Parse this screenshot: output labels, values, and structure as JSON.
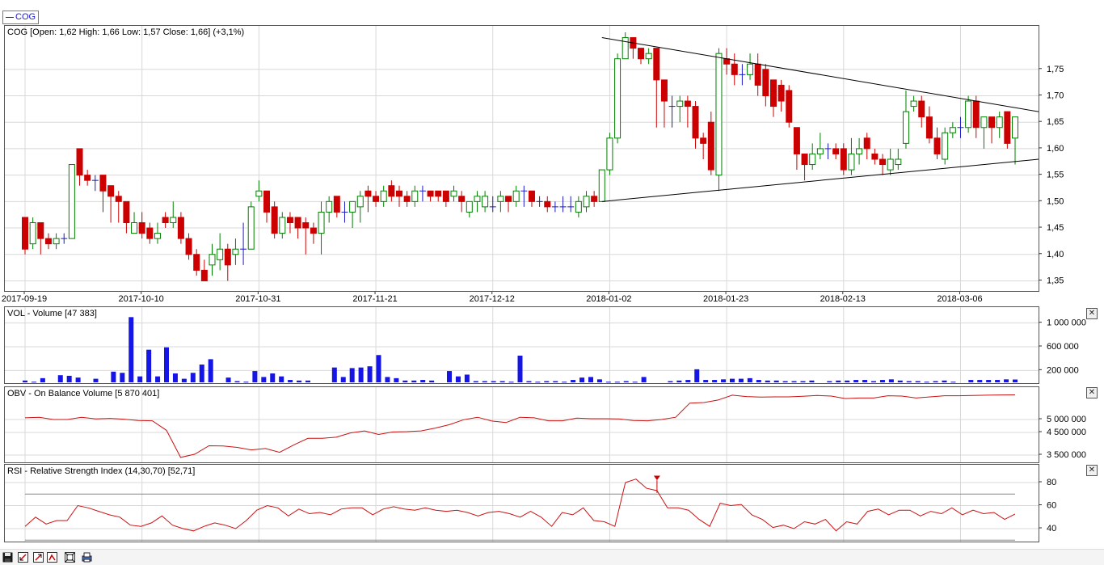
{
  "legend": {
    "label": "COG"
  },
  "main": {
    "title": "COG [Open: 1,62  High: 1,66  Low: 1,57  Close: 1,66] (+3,1%)",
    "y_ticks": [
      "1,35",
      "1,40",
      "1,45",
      "1,50",
      "1,55",
      "1,60",
      "1,65",
      "1,70",
      "1,75"
    ],
    "x_ticks": [
      "2017-09-19",
      "2017-10-10",
      "2017-10-31",
      "2017-11-21",
      "2017-12-12",
      "2018-01-02",
      "2018-01-23",
      "2018-02-13",
      "2018-03-06"
    ]
  },
  "volume": {
    "title": "VOL - Volume [47 383]",
    "y_ticks": [
      "200 000",
      "600 000",
      "1 000 000"
    ]
  },
  "obv": {
    "title": "OBV - On Balance Volume [5 870 401]",
    "y_ticks": [
      "3 500 000",
      "4 500 000",
      "5 000 000"
    ]
  },
  "rsi": {
    "title": "RSI - Relative Strength Index (14,30,70) [52,71]",
    "y_ticks": [
      "40",
      "60",
      "80"
    ]
  },
  "colors": {
    "up": "#008000",
    "down": "#cc0000",
    "up_fill": "#ffffff",
    "doji": "#1a1ac8",
    "volume": "#1515e6",
    "line": "#cc1111",
    "grid": "#d8d8d8"
  },
  "icons": [
    "save-icon",
    "zoom-out-icon",
    "zoom-in-icon",
    "zoom-reset-icon",
    "fit-icon",
    "print-icon"
  ],
  "chart_data": [
    {
      "type": "candlestick",
      "title": "COG [Open: 1,62  High: 1,66  Low: 1,57  Close: 1,66] (+3,1%)",
      "x": [
        "2017-09-19",
        "2017-10-10",
        "2017-10-31",
        "2017-11-21",
        "2017-12-12",
        "2018-01-02",
        "2018-01-23",
        "2018-02-13",
        "2018-03-06"
      ],
      "ylim": [
        1.34,
        1.82
      ],
      "candles": [
        [
          1.47,
          1.41,
          1.47,
          1.4
        ],
        [
          1.42,
          1.46,
          1.47,
          1.41
        ],
        [
          1.46,
          1.43,
          1.46,
          1.4
        ],
        [
          1.43,
          1.42,
          1.44,
          1.41
        ],
        [
          1.42,
          1.43,
          1.44,
          1.41
        ],
        [
          1.43,
          1.43,
          1.44,
          1.42
        ],
        [
          1.43,
          1.57,
          1.57,
          1.43
        ],
        [
          1.6,
          1.55,
          1.6,
          1.53
        ],
        [
          1.55,
          1.54,
          1.56,
          1.53
        ],
        [
          1.54,
          1.54,
          1.55,
          1.52
        ],
        [
          1.55,
          1.52,
          1.55,
          1.48
        ],
        [
          1.53,
          1.51,
          1.53,
          1.46
        ],
        [
          1.51,
          1.5,
          1.52,
          1.46
        ],
        [
          1.5,
          1.46,
          1.5,
          1.44
        ],
        [
          1.44,
          1.46,
          1.48,
          1.44
        ],
        [
          1.46,
          1.44,
          1.48,
          1.43
        ],
        [
          1.45,
          1.43,
          1.46,
          1.42
        ],
        [
          1.43,
          1.44,
          1.46,
          1.42
        ],
        [
          1.47,
          1.46,
          1.48,
          1.45
        ],
        [
          1.46,
          1.47,
          1.5,
          1.45
        ],
        [
          1.47,
          1.43,
          1.48,
          1.42
        ],
        [
          1.43,
          1.4,
          1.44,
          1.39
        ],
        [
          1.4,
          1.37,
          1.41,
          1.36
        ],
        [
          1.37,
          1.35,
          1.39,
          1.35
        ],
        [
          1.38,
          1.4,
          1.42,
          1.36
        ],
        [
          1.39,
          1.41,
          1.44,
          1.37
        ],
        [
          1.41,
          1.38,
          1.42,
          1.35
        ],
        [
          1.4,
          1.41,
          1.43,
          1.38
        ],
        [
          1.41,
          1.41,
          1.46,
          1.38
        ],
        [
          1.41,
          1.49,
          1.5,
          1.41
        ],
        [
          1.51,
          1.52,
          1.54,
          1.5
        ],
        [
          1.52,
          1.48,
          1.52,
          1.46
        ],
        [
          1.49,
          1.44,
          1.5,
          1.43
        ],
        [
          1.44,
          1.47,
          1.48,
          1.43
        ],
        [
          1.47,
          1.46,
          1.48,
          1.44
        ],
        [
          1.47,
          1.45,
          1.47,
          1.43
        ],
        [
          1.46,
          1.45,
          1.47,
          1.4
        ],
        [
          1.45,
          1.44,
          1.46,
          1.42
        ],
        [
          1.44,
          1.48,
          1.5,
          1.4
        ],
        [
          1.48,
          1.5,
          1.51,
          1.46
        ],
        [
          1.51,
          1.48,
          1.51,
          1.47
        ],
        [
          1.48,
          1.48,
          1.5,
          1.46
        ],
        [
          1.48,
          1.5,
          1.5,
          1.45
        ],
        [
          1.49,
          1.51,
          1.52,
          1.46
        ],
        [
          1.52,
          1.51,
          1.53,
          1.48
        ],
        [
          1.51,
          1.5,
          1.52,
          1.49
        ],
        [
          1.5,
          1.52,
          1.53,
          1.49
        ],
        [
          1.53,
          1.51,
          1.54,
          1.5
        ],
        [
          1.52,
          1.51,
          1.53,
          1.49
        ],
        [
          1.51,
          1.5,
          1.52,
          1.49
        ],
        [
          1.5,
          1.52,
          1.53,
          1.49
        ],
        [
          1.52,
          1.52,
          1.53,
          1.5
        ],
        [
          1.52,
          1.51,
          1.52,
          1.5
        ],
        [
          1.52,
          1.51,
          1.52,
          1.5
        ],
        [
          1.52,
          1.5,
          1.52,
          1.49
        ],
        [
          1.51,
          1.52,
          1.53,
          1.5
        ],
        [
          1.51,
          1.5,
          1.52,
          1.48
        ],
        [
          1.48,
          1.5,
          1.5,
          1.47
        ],
        [
          1.5,
          1.51,
          1.52,
          1.48
        ],
        [
          1.49,
          1.51,
          1.52,
          1.48
        ],
        [
          1.49,
          1.49,
          1.51,
          1.48
        ],
        [
          1.5,
          1.51,
          1.52,
          1.48
        ],
        [
          1.51,
          1.5,
          1.51,
          1.48
        ],
        [
          1.5,
          1.52,
          1.53,
          1.49
        ],
        [
          1.52,
          1.52,
          1.53,
          1.49
        ],
        [
          1.52,
          1.5,
          1.52,
          1.49
        ],
        [
          1.5,
          1.5,
          1.51,
          1.49
        ],
        [
          1.5,
          1.49,
          1.51,
          1.48
        ],
        [
          1.49,
          1.49,
          1.5,
          1.48
        ],
        [
          1.49,
          1.49,
          1.51,
          1.48
        ],
        [
          1.49,
          1.49,
          1.51,
          1.48
        ],
        [
          1.48,
          1.5,
          1.51,
          1.47
        ],
        [
          1.49,
          1.51,
          1.52,
          1.48
        ],
        [
          1.51,
          1.5,
          1.52,
          1.49
        ],
        [
          1.5,
          1.56,
          1.56,
          1.5
        ],
        [
          1.56,
          1.62,
          1.63,
          1.55
        ],
        [
          1.62,
          1.77,
          1.78,
          1.61
        ],
        [
          1.77,
          1.81,
          1.82,
          1.77
        ],
        [
          1.81,
          1.79,
          1.81,
          1.77
        ],
        [
          1.79,
          1.77,
          1.79,
          1.76
        ],
        [
          1.77,
          1.78,
          1.79,
          1.76
        ],
        [
          1.79,
          1.73,
          1.79,
          1.64
        ],
        [
          1.73,
          1.69,
          1.73,
          1.64
        ],
        [
          1.68,
          1.68,
          1.7,
          1.64
        ],
        [
          1.68,
          1.69,
          1.7,
          1.65
        ],
        [
          1.69,
          1.68,
          1.7,
          1.64
        ],
        [
          1.68,
          1.62,
          1.69,
          1.6
        ],
        [
          1.62,
          1.61,
          1.63,
          1.58
        ],
        [
          1.65,
          1.56,
          1.67,
          1.55
        ],
        [
          1.55,
          1.78,
          1.79,
          1.52
        ],
        [
          1.77,
          1.76,
          1.79,
          1.74
        ],
        [
          1.76,
          1.74,
          1.78,
          1.72
        ],
        [
          1.74,
          1.74,
          1.76,
          1.72
        ],
        [
          1.74,
          1.76,
          1.78,
          1.73
        ],
        [
          1.76,
          1.72,
          1.78,
          1.7
        ],
        [
          1.75,
          1.7,
          1.76,
          1.68
        ],
        [
          1.73,
          1.68,
          1.73,
          1.66
        ],
        [
          1.72,
          1.69,
          1.73,
          1.67
        ],
        [
          1.71,
          1.65,
          1.72,
          1.64
        ],
        [
          1.64,
          1.59,
          1.64,
          1.56
        ],
        [
          1.59,
          1.57,
          1.59,
          1.54
        ],
        [
          1.57,
          1.59,
          1.61,
          1.56
        ],
        [
          1.59,
          1.6,
          1.63,
          1.58
        ],
        [
          1.6,
          1.6,
          1.61,
          1.58
        ],
        [
          1.6,
          1.59,
          1.61,
          1.58
        ],
        [
          1.6,
          1.56,
          1.61,
          1.55
        ],
        [
          1.56,
          1.59,
          1.62,
          1.55
        ],
        [
          1.59,
          1.6,
          1.62,
          1.57
        ],
        [
          1.62,
          1.6,
          1.63,
          1.58
        ],
        [
          1.59,
          1.58,
          1.6,
          1.57
        ],
        [
          1.58,
          1.57,
          1.59,
          1.55
        ],
        [
          1.56,
          1.58,
          1.6,
          1.55
        ],
        [
          1.57,
          1.58,
          1.6,
          1.56
        ],
        [
          1.61,
          1.67,
          1.71,
          1.6
        ],
        [
          1.68,
          1.69,
          1.7,
          1.67
        ],
        [
          1.69,
          1.66,
          1.7,
          1.64
        ],
        [
          1.66,
          1.62,
          1.68,
          1.61
        ],
        [
          1.62,
          1.59,
          1.64,
          1.58
        ],
        [
          1.58,
          1.63,
          1.64,
          1.57
        ],
        [
          1.63,
          1.64,
          1.65,
          1.62
        ],
        [
          1.64,
          1.64,
          1.66,
          1.62
        ],
        [
          1.64,
          1.69,
          1.7,
          1.63
        ],
        [
          1.69,
          1.64,
          1.7,
          1.62
        ],
        [
          1.64,
          1.66,
          1.66,
          1.6
        ],
        [
          1.66,
          1.64,
          1.66,
          1.61
        ],
        [
          1.64,
          1.66,
          1.67,
          1.62
        ],
        [
          1.67,
          1.61,
          1.67,
          1.6
        ],
        [
          1.62,
          1.66,
          1.66,
          1.57
        ]
      ],
      "trendlines": [
        {
          "from": [
            "2018-01-02",
            1.81
          ],
          "to": [
            "end",
            1.67
          ]
        },
        {
          "from": [
            "2018-01-02",
            1.5
          ],
          "to": [
            "end",
            1.58
          ]
        }
      ]
    },
    {
      "type": "bar",
      "title": "VOL - Volume [47 383]",
      "ylim": [
        0,
        1200000
      ],
      "values": [
        30000,
        10000,
        70000,
        0,
        120000,
        110000,
        80000,
        0,
        60000,
        0,
        180000,
        160000,
        1100000,
        100000,
        550000,
        100000,
        590000,
        150000,
        60000,
        160000,
        300000,
        390000,
        0,
        80000,
        20000,
        10000,
        190000,
        90000,
        150000,
        100000,
        40000,
        30000,
        30000,
        0,
        0,
        250000,
        90000,
        240000,
        250000,
        270000,
        460000,
        90000,
        70000,
        30000,
        30000,
        40000,
        30000,
        0,
        190000,
        100000,
        130000,
        20000,
        20000,
        20000,
        20000,
        10000,
        450000,
        20000,
        10000,
        20000,
        20000,
        10000,
        40000,
        80000,
        90000,
        50000,
        10000,
        10000,
        20000,
        10000,
        90000,
        0,
        0,
        20000,
        30000,
        40000,
        220000,
        40000,
        40000,
        50000,
        60000,
        60000,
        70000,
        40000,
        30000,
        30000,
        20000,
        20000,
        20000,
        30000,
        0,
        20000,
        30000,
        30000,
        40000,
        40000,
        20000,
        40000,
        50000,
        30000,
        20000,
        20000,
        10000,
        20000,
        30000,
        10000,
        0,
        40000,
        40000,
        40000,
        40000,
        50000,
        47383
      ],
      "ytick_labels": [
        "200 000",
        "600 000",
        "1 000 000"
      ]
    },
    {
      "type": "line",
      "title": "OBV - On Balance Volume [5 870 401]",
      "series": [
        {
          "values": [
            5060000,
            5080000,
            5000000,
            5000000,
            5080000,
            5020000,
            5040000,
            5010000,
            4960000,
            4950000,
            4580000,
            3340000,
            3540000,
            3910000,
            3900000,
            3840000,
            3730000,
            3790000,
            3620000,
            3950000,
            4240000,
            4240000,
            4290000,
            4480000,
            4560000,
            4410000,
            4520000,
            4530000,
            4560000,
            4670000,
            4800000,
            4990000,
            5080000,
            4940000,
            4880000,
            5080000,
            5060000,
            4950000,
            4950000,
            5050000,
            5030000,
            5030000,
            5020000,
            4960000,
            4950000,
            5000000,
            5080000,
            5580000,
            5600000,
            5690000,
            5860000,
            5810000,
            5790000,
            5800000,
            5800000,
            5820000,
            5850000,
            5830000,
            5740000,
            5760000,
            5760000,
            5840000,
            5830000,
            5760000,
            5800000,
            5840000,
            5840000,
            5850000,
            5860000,
            5870000,
            5870401
          ]
        }
      ],
      "ytick_labels": [
        "3 500 000",
        "4 500 000",
        "5 000 000"
      ]
    },
    {
      "type": "line",
      "title": "RSI - Relative Strength Index (14,30,70) [52,71]",
      "ylim": [
        30,
        90
      ],
      "series": [
        {
          "values": [
            42,
            50,
            44,
            47,
            47,
            60,
            58,
            55,
            52,
            50,
            43,
            42,
            45,
            51,
            43,
            40,
            38,
            42,
            45,
            43,
            40,
            47,
            56,
            60,
            58,
            51,
            57,
            53,
            54,
            52,
            57,
            58,
            58,
            52,
            57,
            59,
            57,
            56,
            58,
            56,
            55,
            56,
            54,
            51,
            54,
            55,
            53,
            50,
            55,
            50,
            42,
            54,
            52,
            58,
            47,
            46,
            42,
            80,
            83,
            75,
            73,
            58,
            58,
            56,
            48,
            42,
            62,
            60,
            61,
            52,
            48,
            41,
            43,
            40,
            46,
            44,
            48,
            38,
            46,
            44,
            55,
            57,
            52,
            56,
            56,
            51,
            55,
            53,
            58,
            52,
            56,
            53,
            54,
            48,
            52.71
          ]
        }
      ],
      "reference_lines": [
        30,
        70
      ],
      "ytick_labels": [
        "40",
        "60",
        "80"
      ]
    }
  ]
}
